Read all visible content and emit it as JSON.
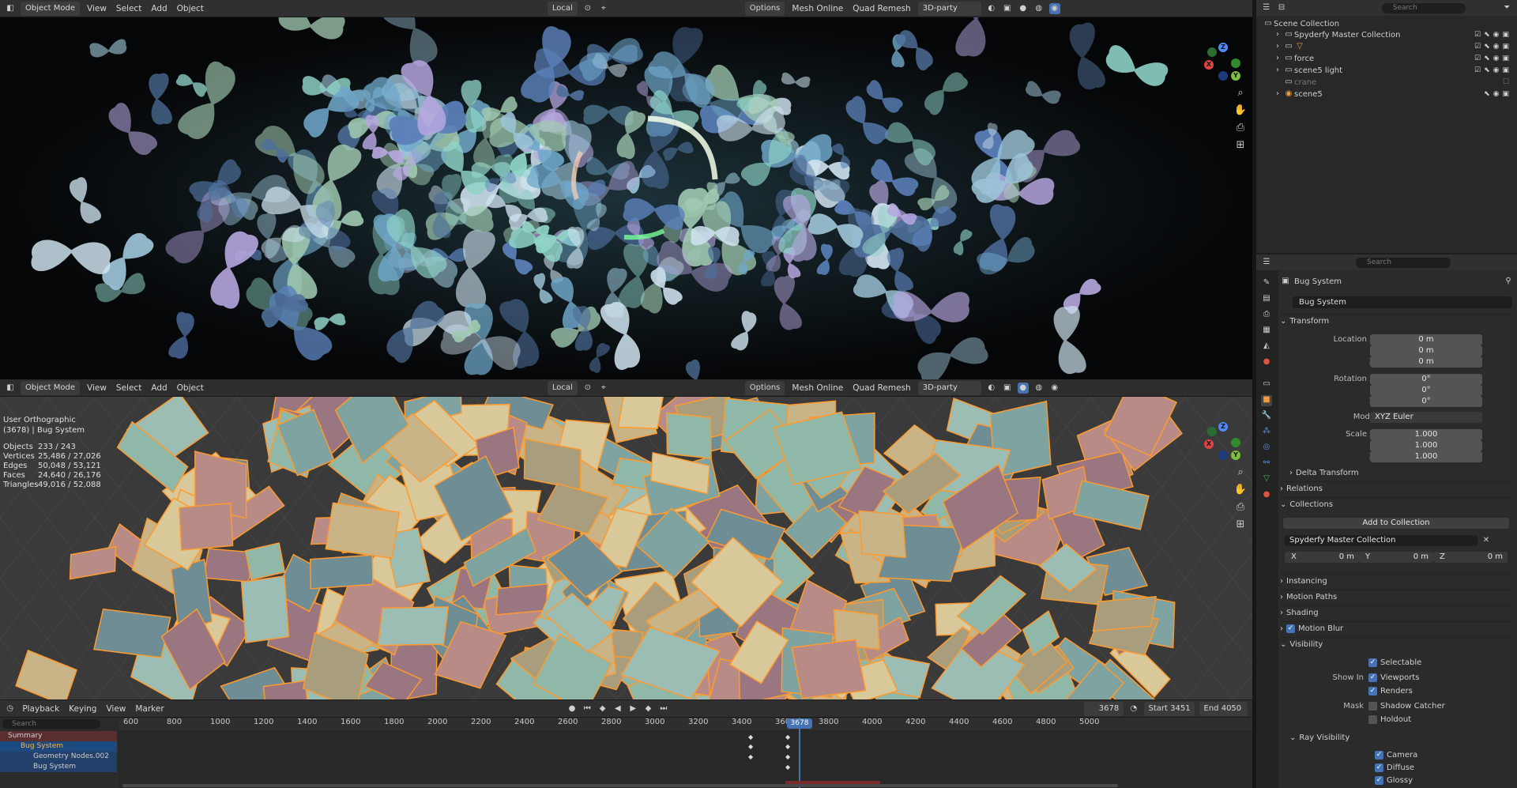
{
  "top_header": {
    "mode": "Object Mode",
    "menus": [
      "View",
      "Select",
      "Add",
      "Object"
    ],
    "orientation": "Local",
    "options": "Options",
    "addons": [
      "Mesh Online",
      "Quad Remesh",
      "3D-party"
    ]
  },
  "bottom_header": {
    "mode": "Object Mode",
    "menus": [
      "View",
      "Select",
      "Add",
      "Object"
    ],
    "orientation": "Local",
    "options": "Options",
    "addons": [
      "Mesh Online",
      "Quad Remesh",
      "3D-party"
    ]
  },
  "viewport_bottom": {
    "view_name": "User Orthographic",
    "context": "(3678)  | Bug System",
    "stats": [
      {
        "label": "Objects",
        "value": "233 / 243"
      },
      {
        "label": "Vertices",
        "value": "25,486 / 27,026"
      },
      {
        "label": "Edges",
        "value": "50,048 / 53,121"
      },
      {
        "label": "Faces",
        "value": "24,640 / 26,176"
      },
      {
        "label": "Triangles",
        "value": "49,016 / 52,088"
      }
    ]
  },
  "outliner": {
    "search_placeholder": "Search",
    "root": "Scene Collection",
    "items": [
      "Spyderfy Master Collection",
      "force",
      "scene5 light",
      "crane",
      "scene5"
    ]
  },
  "properties": {
    "search_placeholder": "Search",
    "object_name": "Bug System",
    "object_field": "Bug System",
    "transform_label": "Transform",
    "location_label": "Location X",
    "location": [
      "0 m",
      "0 m",
      "0 m"
    ],
    "rotation_label": "Rotation X",
    "rotation": [
      "0°",
      "0°",
      "0°"
    ],
    "mode_label": "Mode",
    "mode_value": "XYZ Euler",
    "scale_label": "Scale X",
    "scale": [
      "1.000",
      "1.000",
      "1.000"
    ],
    "y_label": "Y",
    "z_label": "Z",
    "delta_transform": "Delta Transform",
    "relations": "Relations",
    "collections": "Collections",
    "add_to_collection": "Add to Collection",
    "collection_name": "Spyderfy Master Collection",
    "collection_offset": {
      "x_label": "X",
      "x": "0 m",
      "y_label": "Y",
      "y": "0 m",
      "z_label": "Z",
      "z": "0 m"
    },
    "instancing": "Instancing",
    "motion_paths": "Motion Paths",
    "shading": "Shading",
    "motion_blur": "Motion Blur",
    "visibility": "Visibility",
    "selectable": "Selectable",
    "show_in": "Show In",
    "viewports": "Viewports",
    "renders": "Renders",
    "mask": "Mask",
    "shadow_catcher": "Shadow Catcher",
    "holdout": "Holdout",
    "ray_visibility": "Ray Visibility",
    "camera": "Camera",
    "diffuse": "Diffuse",
    "glossy": "Glossy"
  },
  "timeline": {
    "menus": [
      "Playback",
      "Keying",
      "View",
      "Marker"
    ],
    "current_frame": "3678",
    "start_label": "Start",
    "start": "3451",
    "end_label": "End",
    "end": "4050",
    "search_placeholder": "Search",
    "ticks": [
      "600",
      "800",
      "1000",
      "1200",
      "1400",
      "1600",
      "1800",
      "2000",
      "2200",
      "2400",
      "2600",
      "2800",
      "3000",
      "3200",
      "3400",
      "3600",
      "3800",
      "4000",
      "4200",
      "4400",
      "4600",
      "4800",
      "5000"
    ],
    "channels": [
      "Summary",
      "Bug System",
      "Geometry Nodes.002",
      "Bug System"
    ]
  },
  "colors": {
    "accent": "#4772b3",
    "selection": "#ff9a2e",
    "header": "#303030",
    "panel": "#282828"
  }
}
